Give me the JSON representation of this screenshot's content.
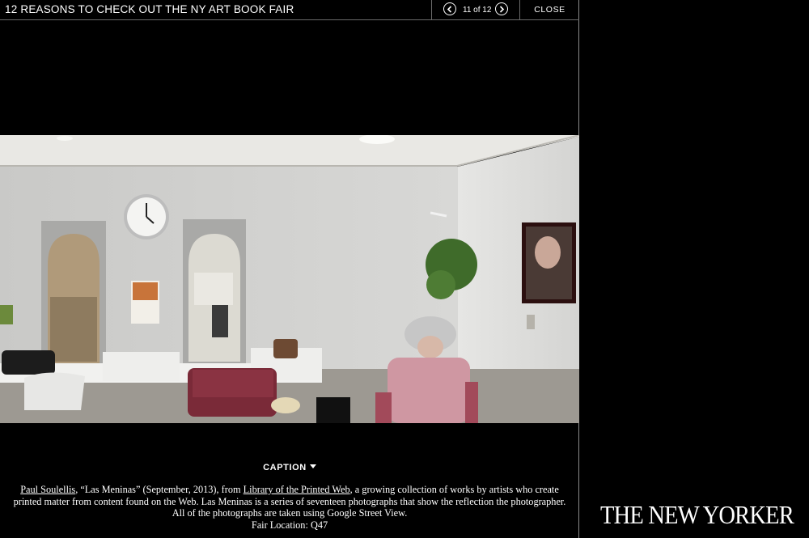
{
  "header": {
    "title": "12 REASONS TO CHECK OUT THE NY ART BOOK FAIR",
    "counter": "11 of 12",
    "close_label": "CLOSE",
    "prev_icon": "chevron-left-icon",
    "next_icon": "chevron-right-icon"
  },
  "photo": {
    "subject": "salon interior with mirrors, clock, hair dryer chairs and framed portrait"
  },
  "caption": {
    "toggle_label": "CAPTION",
    "artist_link": "Paul Soulellis",
    "text_1": ", “Las Meninas” (September, 2013), from ",
    "collection_link": "Library of the Printed Web",
    "text_2": ", a growing collection of works by artists who create printed matter from content found on the Web. Las Meninas is a series of seventeen photographs that show the reflection the photographer. All of the photographs are taken using Google Street View.",
    "location": "Fair Location: Q47"
  },
  "brand": {
    "logo": "THE NEW YORKER"
  },
  "colors": {
    "background": "#000000",
    "text": "#ffffff",
    "divider": "#6a6a6a"
  }
}
